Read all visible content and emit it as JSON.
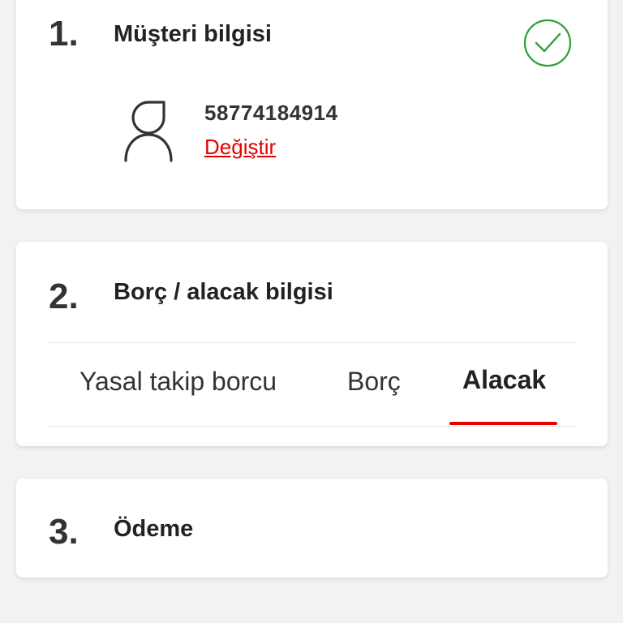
{
  "steps": {
    "customer": {
      "number": "1.",
      "title": "Müşteri bilgisi",
      "status_icon": "check-circle-icon",
      "status_color": "#2e9e3e",
      "customer_id": "58774184914",
      "change_label": "Değiştir"
    },
    "debt_credit": {
      "number": "2.",
      "title": "Borç / alacak bilgisi",
      "tabs": [
        {
          "label": "Yasal takip borcu",
          "active": false
        },
        {
          "label": "Borç",
          "active": false
        },
        {
          "label": "Alacak",
          "active": true
        }
      ]
    },
    "payment": {
      "number": "3.",
      "title": "Ödeme"
    }
  },
  "colors": {
    "accent": "#e60000",
    "success": "#2e9e3e",
    "background": "#f2f2f2"
  }
}
